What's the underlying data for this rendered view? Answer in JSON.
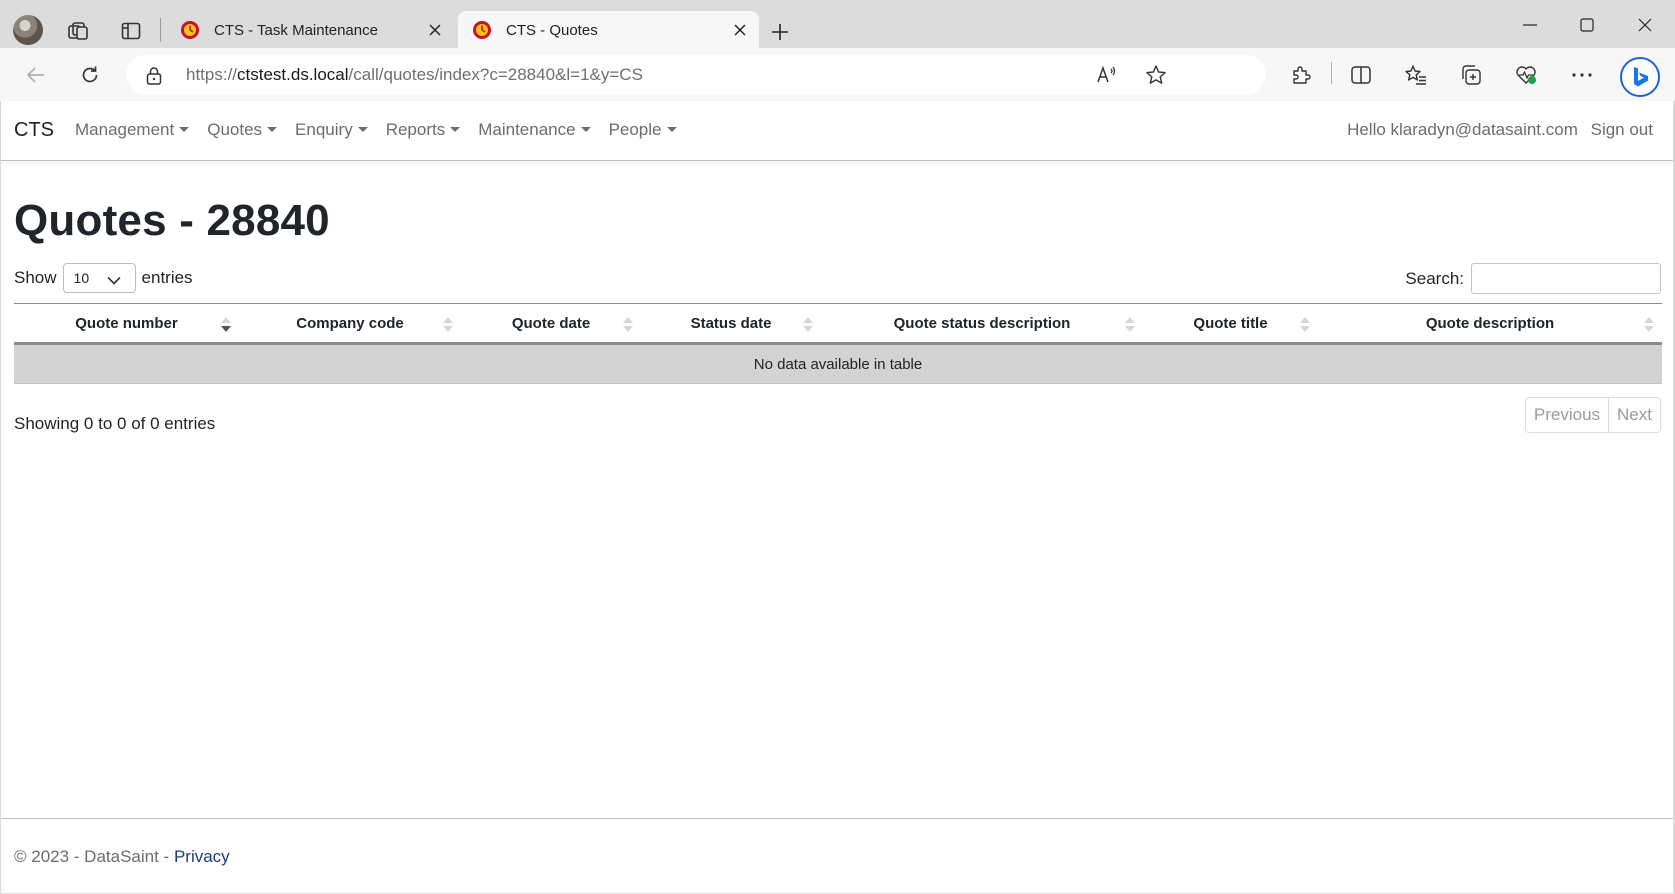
{
  "browser": {
    "tabs": [
      {
        "title": "CTS - Task Maintenance",
        "active": false
      },
      {
        "title": "CTS - Quotes",
        "active": true
      }
    ],
    "url": {
      "prefix": "https://",
      "host": "ctstest.ds.local",
      "path": "/call/quotes/index?c=28840&l=1&y=CS"
    },
    "icons": [
      "profile-avatar",
      "workspaces-icon",
      "tab-actions-icon",
      "back-icon",
      "refresh-icon",
      "lock-icon",
      "read-aloud-icon",
      "favorite-star-icon",
      "extensions-icon",
      "split-screen-icon",
      "favorites-icon",
      "collections-icon",
      "browser-essentials-icon",
      "more-icon",
      "bing-copilot-icon"
    ]
  },
  "navbar": {
    "brand": "CTS",
    "items": [
      "Management",
      "Quotes",
      "Enquiry",
      "Reports",
      "Maintenance",
      "People"
    ],
    "greeting": "Hello klaradyn@datasaint.com",
    "signout": "Sign out"
  },
  "page": {
    "title": "Quotes - 28840",
    "length": {
      "show": "Show",
      "value": "10",
      "entries": "entries"
    },
    "search_label": "Search:",
    "table": {
      "columns": [
        "Quote number",
        "Company code",
        "Quote date",
        "Status date",
        "Quote status description",
        "Quote title",
        "Quote description"
      ],
      "empty": "No data available in table"
    },
    "info": "Showing 0 to 0 of 0 entries",
    "pager": {
      "previous": "Previous",
      "next": "Next"
    }
  },
  "footer": {
    "copyright": "© 2023 - DataSaint - ",
    "privacy": "Privacy"
  }
}
